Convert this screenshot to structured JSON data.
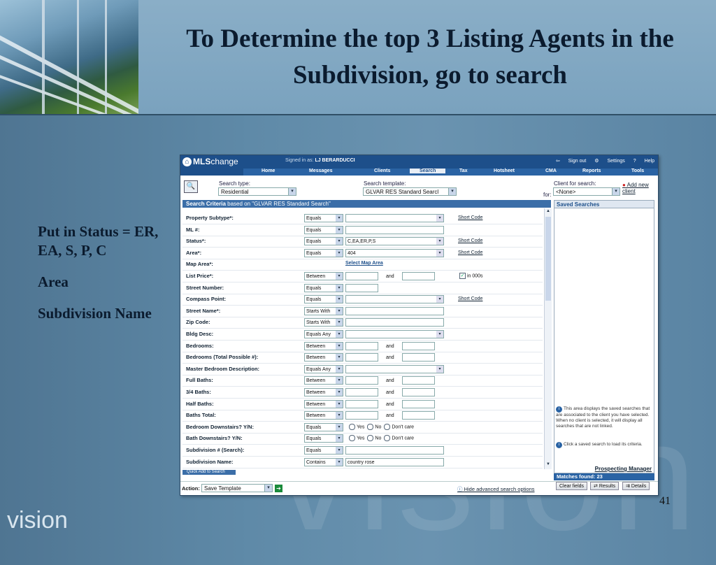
{
  "slide": {
    "title": "To Determine the top 3 Listing Agents in the Subdivision, go to search",
    "notes": [
      "Put in Status = ER, EA, S, P, C",
      "Area",
      "Subdivision Name"
    ],
    "brand": "vision",
    "page_number": "41"
  },
  "app": {
    "logo_mls": "MLS",
    "logo_change": "change",
    "signed_in_label": "Signed in as:",
    "signed_in_user": "LJ BERARDUCCI",
    "top_links": [
      "Sign out",
      "Settings",
      "Help"
    ],
    "nav_tabs": [
      "Home",
      "Messages",
      "Clients",
      "Search",
      "Tax",
      "Hotsheet",
      "CMA",
      "Reports",
      "Tools"
    ],
    "active_tab": "Search",
    "search_type_label": "Search type:",
    "search_type_value": "Residential",
    "search_template_label": "Search template:",
    "search_template_value": "GLVAR RES Standard Searcl",
    "for_label": "for:",
    "client_label": "Client for search:",
    "client_value": "<None>",
    "add_new_client": "Add new client",
    "criteria_title": "Search Criteria",
    "criteria_based": "based on \"GLVAR RES Standard Search\"",
    "saved_searches_title": "Saved Searches",
    "saved_info_1": "This area displays the saved searches that are associated to the client you have selected. When no client is selected, it will display all searches that are not linked.",
    "saved_info_2": "Click a saved search to load its criteria.",
    "prospecting_manager": "Prospecting Manager",
    "matches_found": "Matches found: 23",
    "quick_add": "Quick Add to Search",
    "action_label": "Action:",
    "action_value": "Save Template",
    "hide_advanced": "Hide advanced search options",
    "buttons": {
      "clear": "Clear fields",
      "results": "Results",
      "details": "Details"
    },
    "and_label": "and",
    "short_code": "Short Code",
    "select_map_area": "Select Map Area",
    "in_000s": "in 000s",
    "radio_options": [
      "Yes",
      "No",
      "Don't care"
    ]
  },
  "fields": [
    {
      "label": "Property Subtype*:",
      "op": "Equals",
      "kind": "select",
      "value": "",
      "short": true
    },
    {
      "label": "ML #:",
      "op": "Equals",
      "kind": "text",
      "value": ""
    },
    {
      "label": "Status*:",
      "op": "Equals",
      "kind": "select",
      "value": "C,EA,ER,P,S",
      "short": true
    },
    {
      "label": "Area*:",
      "op": "Equals",
      "kind": "select",
      "value": "404",
      "short": true
    },
    {
      "label": "Map Area*:",
      "op": "",
      "kind": "maplink",
      "value": ""
    },
    {
      "label": "List Price*:",
      "op": "Between",
      "kind": "range",
      "value": "",
      "in000s": true
    },
    {
      "label": "Street Number:",
      "op": "Equals",
      "kind": "small",
      "value": ""
    },
    {
      "label": "Compass Point:",
      "op": "Equals",
      "kind": "select",
      "value": "",
      "short": true
    },
    {
      "label": "Street Name*:",
      "op": "Starts With",
      "kind": "text",
      "value": ""
    },
    {
      "label": "Zip Code:",
      "op": "Starts With",
      "kind": "text",
      "value": ""
    },
    {
      "label": "Bldg Desc:",
      "op": "Equals Any",
      "kind": "select",
      "value": ""
    },
    {
      "label": "Bedrooms:",
      "op": "Between",
      "kind": "range",
      "value": ""
    },
    {
      "label": "Bedrooms (Total Possible #):",
      "op": "Between",
      "kind": "range",
      "value": ""
    },
    {
      "label": "Master Bedroom Description:",
      "op": "Equals Any",
      "kind": "select",
      "value": ""
    },
    {
      "label": "Full Baths:",
      "op": "Between",
      "kind": "range",
      "value": ""
    },
    {
      "label": "3/4 Baths:",
      "op": "Between",
      "kind": "range",
      "value": ""
    },
    {
      "label": "Half Baths:",
      "op": "Between",
      "kind": "range",
      "value": ""
    },
    {
      "label": "Baths Total:",
      "op": "Between",
      "kind": "range",
      "value": ""
    },
    {
      "label": "Bedroom Downstairs? Y/N:",
      "op": "Equals",
      "kind": "radio",
      "value": ""
    },
    {
      "label": "Bath Downstairs? Y/N:",
      "op": "Equals",
      "kind": "radio",
      "value": ""
    },
    {
      "label": "Subdivision # (Search):",
      "op": "Equals",
      "kind": "text",
      "value": ""
    },
    {
      "label": "Subdivision Name:",
      "op": "Contains",
      "kind": "text",
      "value": "country rose"
    }
  ],
  "colors": {
    "app_blue": "#1d4f8a",
    "criteria_bar": "#3b6ea8",
    "slide_bg": "#5f8aa8"
  }
}
